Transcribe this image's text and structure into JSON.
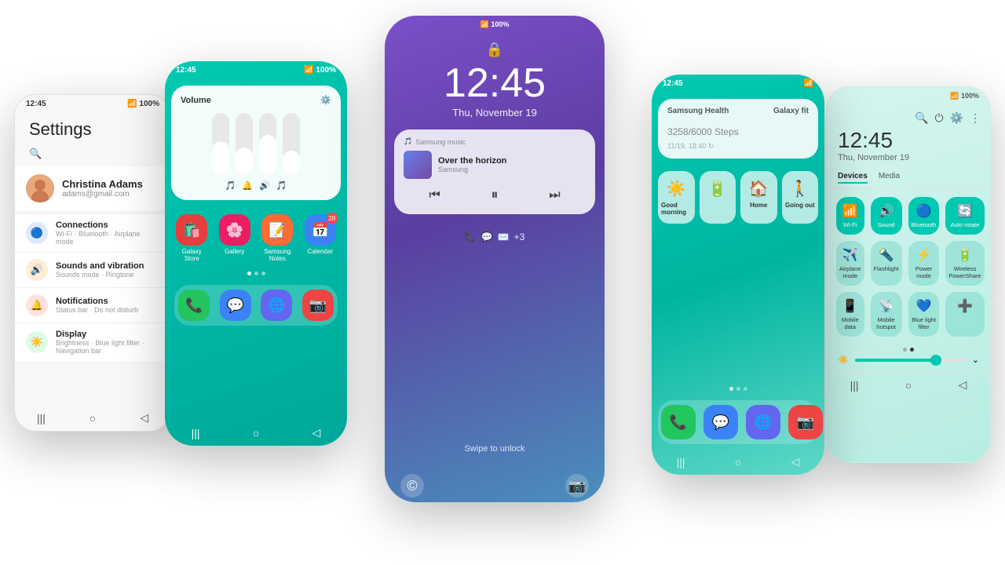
{
  "phone1": {
    "status": {
      "time": "12:45",
      "signal": "📶 100%"
    },
    "title": "Settings",
    "profile": {
      "name": "Christina Adams",
      "email": "adams@gmail.com"
    },
    "items": [
      {
        "icon": "🔵",
        "color": "#3b82f6",
        "title": "Connections",
        "sub": "Wi-Fi · Bluetooth · Airplane mode"
      },
      {
        "icon": "🔊",
        "color": "#f97316",
        "title": "Sounds and vibration",
        "sub": "Sounds mode · Ringtone"
      },
      {
        "icon": "🔔",
        "color": "#ef4444",
        "title": "Notifications",
        "sub": "Status bar · Do not disturb"
      },
      {
        "icon": "☀️",
        "color": "#22c55e",
        "title": "Display",
        "sub": "Brightness · Blue light filter · Navigation bar"
      }
    ]
  },
  "phone2": {
    "status": {
      "time": "12:45",
      "signal": "📶 100%"
    },
    "volume": {
      "title": "Volume",
      "sliders": [
        55,
        45,
        65,
        40
      ],
      "icons": [
        "🎵",
        "🔔",
        "🔊",
        "🎵"
      ]
    },
    "apps": [
      {
        "label": "Galaxy Store",
        "color": "#e53e3e",
        "emoji": "🛍️"
      },
      {
        "label": "Gallery",
        "color": "#e91e63",
        "emoji": "🌸"
      },
      {
        "label": "Samsung Notes",
        "color": "#ff6b35",
        "emoji": "📝"
      },
      {
        "label": "Calendar",
        "color": "#3b82f6",
        "emoji": "📅",
        "badge": "28"
      }
    ],
    "dock": [
      {
        "label": "Phone",
        "color": "#22c55e",
        "emoji": "📞"
      },
      {
        "label": "Messages",
        "color": "#3b82f6",
        "emoji": "💬"
      },
      {
        "label": "Internet",
        "color": "#6366f1",
        "emoji": "🌐"
      },
      {
        "label": "Camera",
        "color": "#ef4444",
        "emoji": "📷"
      }
    ]
  },
  "phone3": {
    "time": "12:45",
    "date": "Thu, November 19",
    "music": {
      "app": "Samsung music",
      "title": "Over the horizon",
      "artist": "Samsung"
    },
    "swipe": "Swipe to unlock",
    "notif_icons": [
      "📞",
      "💬",
      "✉️",
      "+3"
    ]
  },
  "phone4": {
    "status": {
      "time": "12:45"
    },
    "health": {
      "title": "Samsung Health",
      "device": "Galaxy fit",
      "steps": "3258",
      "goal": "/6000 Steps",
      "meta": "11/19, 18:40 ↻"
    },
    "shortcuts": [
      {
        "label": "Good morning",
        "emoji": "☀️"
      },
      {
        "label": "",
        "emoji": "🔋"
      },
      {
        "label": "Home",
        "emoji": "🏠"
      },
      {
        "label": "Going out",
        "emoji": "🚶"
      }
    ],
    "dock": [
      {
        "emoji": "📞",
        "color": "#22c55e"
      },
      {
        "emoji": "💬",
        "color": "#3b82f6"
      },
      {
        "emoji": "🌐",
        "color": "#6366f1"
      },
      {
        "emoji": "📷",
        "color": "#ef4444"
      }
    ]
  },
  "phone5": {
    "status": {
      "signal": "📶 100%"
    },
    "time": "12:45",
    "date": "Thu, November 19",
    "tabs": [
      "Devices",
      "Media"
    ],
    "tiles": [
      {
        "label": "Wi-Fi",
        "emoji": "📶",
        "active": true
      },
      {
        "label": "Sound",
        "emoji": "🔊",
        "active": true
      },
      {
        "label": "Bluetooth",
        "emoji": "🔵",
        "active": true
      },
      {
        "label": "Auto rotate",
        "emoji": "🔄",
        "active": true
      },
      {
        "label": "Airplane mode",
        "emoji": "✈️",
        "active": false
      },
      {
        "label": "Flashlight",
        "emoji": "🔦",
        "active": false
      },
      {
        "label": "Power mode",
        "emoji": "⚡",
        "active": false
      },
      {
        "label": "Wireless PowerShare",
        "emoji": "🔋",
        "active": false
      },
      {
        "label": "Mobile data",
        "emoji": "📱",
        "active": false
      },
      {
        "label": "Mobile hotspot",
        "emoji": "📡",
        "active": false
      },
      {
        "label": "Blue light filter",
        "emoji": "💙",
        "active": false
      },
      {
        "label": "+",
        "emoji": "➕",
        "active": false
      }
    ]
  }
}
